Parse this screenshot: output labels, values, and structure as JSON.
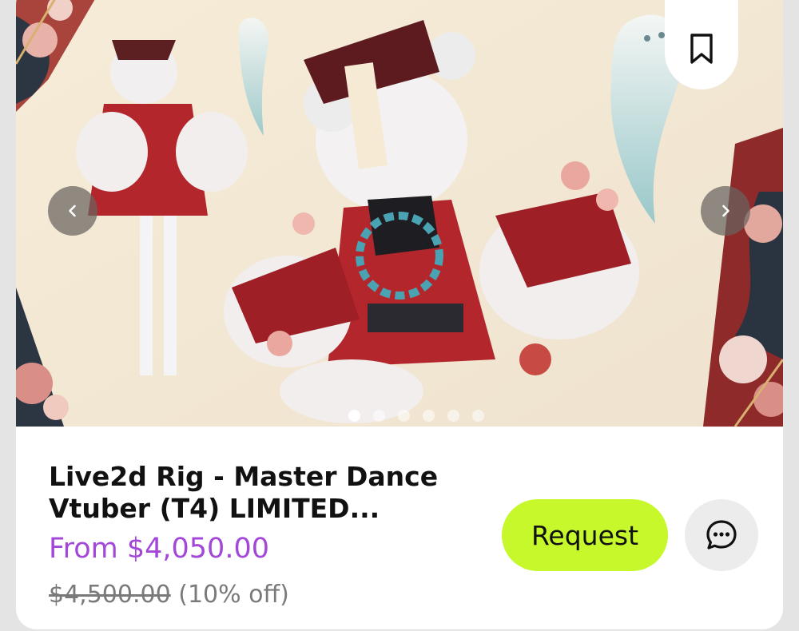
{
  "listing": {
    "title_line1": "Live2d Rig - Master Dance",
    "title_line2": "Vtuber (T4) LIMITED...",
    "price_prefix": "From",
    "price": "$4,050.00",
    "original_price": "$4,500.00",
    "discount": "(10% off)"
  },
  "carousel": {
    "slide_count": 6,
    "active_index": 0,
    "image_alt": "Anime character in red and white jiangshi-style outfit with ghosts and flowers"
  },
  "actions": {
    "request_label": "Request",
    "bookmark_icon": "bookmark-icon",
    "chat_icon": "chat-bubble-icon",
    "prev_icon": "chevron-left-icon",
    "next_icon": "chevron-right-icon"
  },
  "colors": {
    "accent_price": "#a347d8",
    "request_bg": "#c6f82b"
  }
}
